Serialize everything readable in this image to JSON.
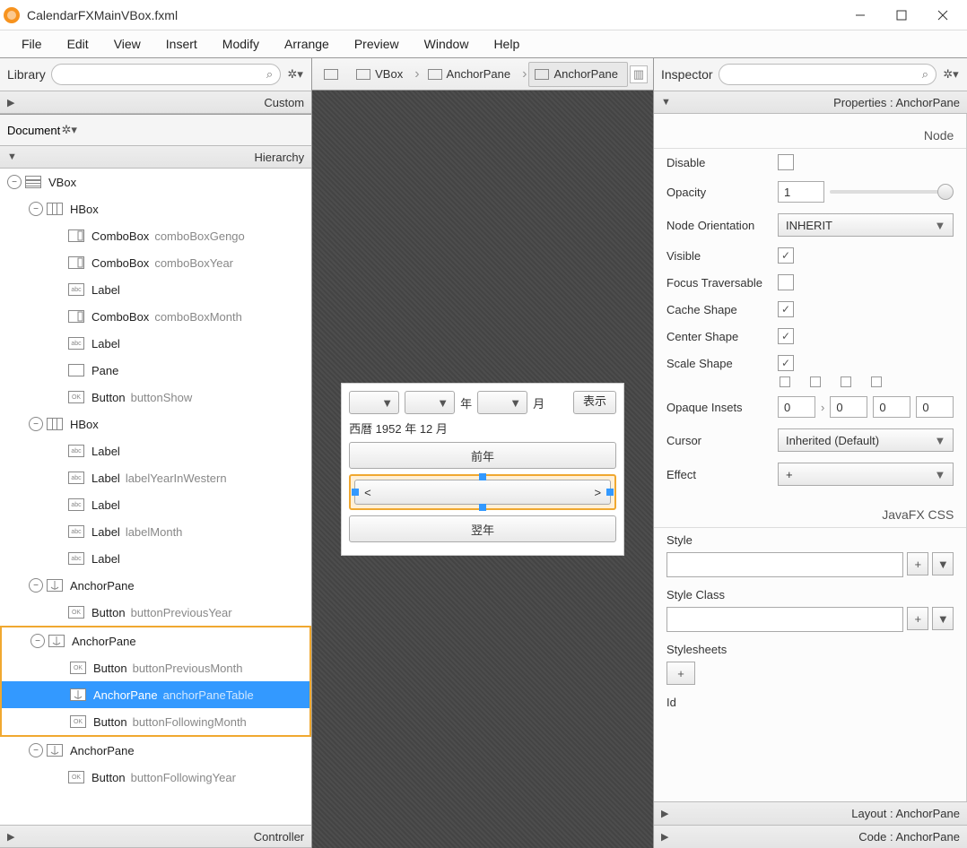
{
  "window": {
    "title": "CalendarFXMainVBox.fxml"
  },
  "menu": {
    "file": "File",
    "edit": "Edit",
    "view": "View",
    "insert": "Insert",
    "modify": "Modify",
    "arrange": "Arrange",
    "preview": "Preview",
    "window": "Window",
    "help": "Help"
  },
  "library": {
    "title": "Library",
    "custom": "Custom"
  },
  "document": {
    "title": "Document",
    "hierarchy": "Hierarchy",
    "controller": "Controller"
  },
  "hierarchy": [
    {
      "depth": 0,
      "disc": "−",
      "type": "vbox",
      "name": "VBox",
      "id": ""
    },
    {
      "depth": 1,
      "disc": "−",
      "type": "hbox",
      "name": "HBox",
      "id": ""
    },
    {
      "depth": 2,
      "disc": "",
      "type": "combo",
      "name": "ComboBox",
      "id": "comboBoxGengo"
    },
    {
      "depth": 2,
      "disc": "",
      "type": "combo",
      "name": "ComboBox",
      "id": "comboBoxYear"
    },
    {
      "depth": 2,
      "disc": "",
      "type": "label",
      "name": "Label",
      "id": ""
    },
    {
      "depth": 2,
      "disc": "",
      "type": "combo",
      "name": "ComboBox",
      "id": "comboBoxMonth"
    },
    {
      "depth": 2,
      "disc": "",
      "type": "label",
      "name": "Label",
      "id": ""
    },
    {
      "depth": 2,
      "disc": "",
      "type": "pane",
      "name": "Pane",
      "id": ""
    },
    {
      "depth": 2,
      "disc": "",
      "type": "button",
      "name": "Button",
      "id": "buttonShow"
    },
    {
      "depth": 1,
      "disc": "−",
      "type": "hbox",
      "name": "HBox",
      "id": ""
    },
    {
      "depth": 2,
      "disc": "",
      "type": "label",
      "name": "Label",
      "id": ""
    },
    {
      "depth": 2,
      "disc": "",
      "type": "label",
      "name": "Label",
      "id": "labelYearInWestern"
    },
    {
      "depth": 2,
      "disc": "",
      "type": "label",
      "name": "Label",
      "id": ""
    },
    {
      "depth": 2,
      "disc": "",
      "type": "label",
      "name": "Label",
      "id": "labelMonth"
    },
    {
      "depth": 2,
      "disc": "",
      "type": "label",
      "name": "Label",
      "id": ""
    },
    {
      "depth": 1,
      "disc": "−",
      "type": "anchor",
      "name": "AnchorPane",
      "id": ""
    },
    {
      "depth": 2,
      "disc": "",
      "type": "button",
      "name": "Button",
      "id": "buttonPreviousYear"
    },
    {
      "depth": 1,
      "disc": "−",
      "type": "anchor",
      "name": "AnchorPane",
      "id": "",
      "hlstart": true
    },
    {
      "depth": 2,
      "disc": "",
      "type": "button",
      "name": "Button",
      "id": "buttonPreviousMonth"
    },
    {
      "depth": 2,
      "disc": "",
      "type": "anchor",
      "name": "AnchorPane",
      "id": "anchorPaneTable",
      "selected": true
    },
    {
      "depth": 2,
      "disc": "",
      "type": "button",
      "name": "Button",
      "id": "buttonFollowingMonth",
      "hlend": true
    },
    {
      "depth": 1,
      "disc": "−",
      "type": "anchor",
      "name": "AnchorPane",
      "id": ""
    },
    {
      "depth": 2,
      "disc": "",
      "type": "button",
      "name": "Button",
      "id": "buttonFollowingYear"
    }
  ],
  "breadcrumb": {
    "seg1": "VBox",
    "seg2": "AnchorPane",
    "seg3": "AnchorPane"
  },
  "mock": {
    "yearSuf": "年",
    "monthSuf": "月",
    "show": "表示",
    "line2": "西暦 1952 年 12 月",
    "prevYear": "前年",
    "nextYear": "翌年",
    "lt": "<",
    "gt": ">"
  },
  "inspector": {
    "title": "Inspector",
    "props": "Properties : AnchorPane",
    "layout": "Layout : AnchorPane",
    "code": "Code : AnchorPane",
    "sec_node": "Node",
    "sec_css": "JavaFX CSS",
    "disable": "Disable",
    "opacity": "Opacity",
    "opacity_val": "1",
    "nodeOri": "Node Orientation",
    "nodeOri_val": "INHERIT",
    "visible": "Visible",
    "focus": "Focus Traversable",
    "cache": "Cache Shape",
    "center": "Center Shape",
    "scale": "Scale Shape",
    "opaque": "Opaque Insets",
    "oi1": "0",
    "oi2": "0",
    "oi3": "0",
    "oi4": "0",
    "cursor": "Cursor",
    "cursor_val": "Inherited (Default)",
    "effect": "Effect",
    "effect_val": "+",
    "style": "Style",
    "styleclass": "Style Class",
    "stylesheets": "Stylesheets",
    "plus": "+",
    "id": "Id"
  }
}
